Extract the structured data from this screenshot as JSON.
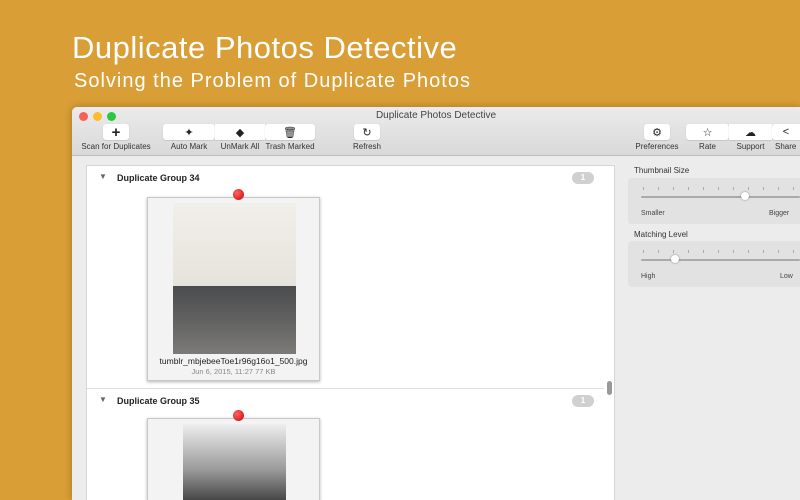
{
  "hero": {
    "title": "Duplicate Photos Detective",
    "subtitle": "Solving the Problem of Duplicate Photos"
  },
  "window": {
    "title": "Duplicate Photos Detective"
  },
  "toolbar": {
    "scan": "Scan for Duplicates",
    "auto_mark": "Auto Mark",
    "unmark_all": "UnMark All",
    "trash_marked": "Trash Marked",
    "refresh": "Refresh",
    "preferences": "Preferences",
    "rate": "Rate",
    "support": "Support",
    "share": "Share"
  },
  "groups": [
    {
      "title": "Duplicate Group 34",
      "count": "1",
      "file": "tumblr_mbjebeeToe1r96g16o1_500.jpg",
      "meta": "Jun 6, 2015, 11:27 77 KB"
    },
    {
      "title": "Duplicate Group 35",
      "count": "1"
    }
  ],
  "sidebar": {
    "thumbnail": {
      "label": "Thumbnail Size",
      "min": "Smaller",
      "max": "Bigger",
      "value_fraction": 0.66
    },
    "matching": {
      "label": "Matching Level",
      "min": "High",
      "max": "Low",
      "value_fraction": 0.2
    }
  }
}
